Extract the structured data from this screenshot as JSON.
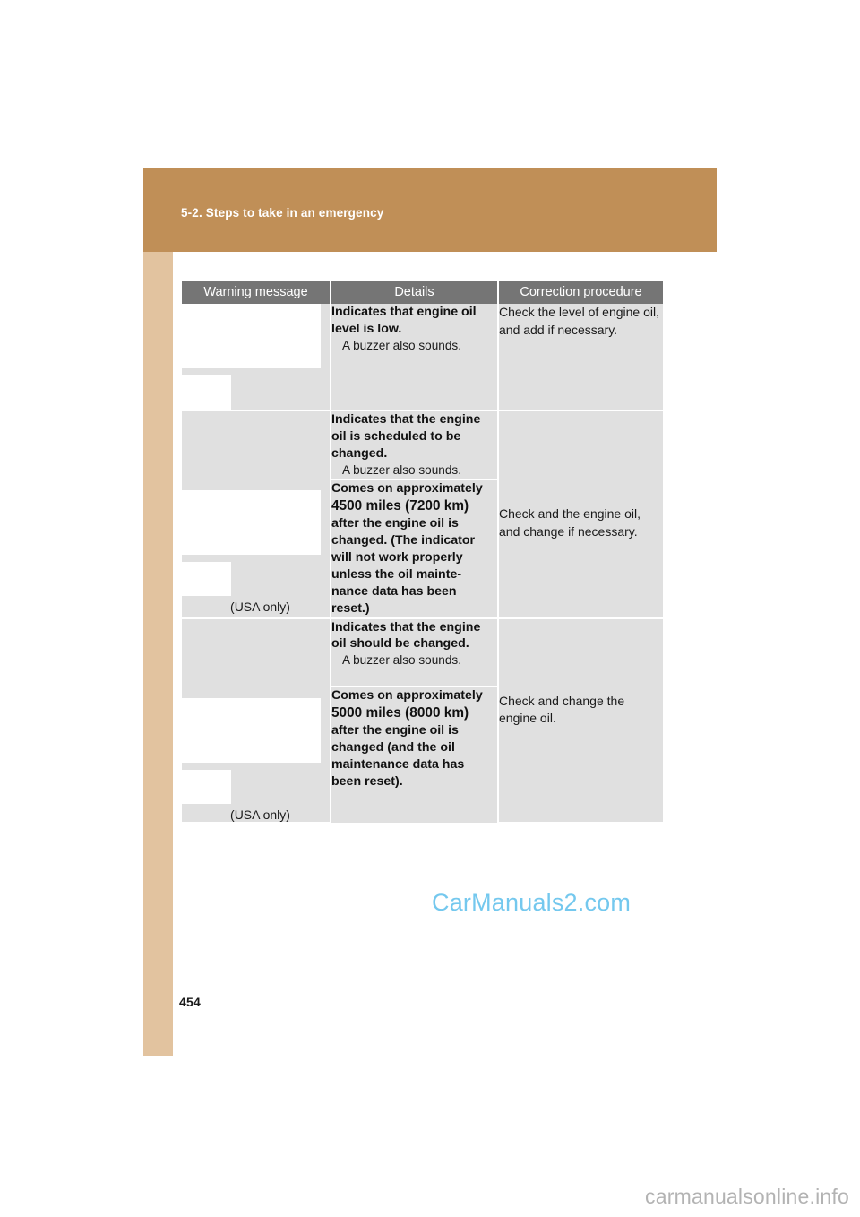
{
  "page": {
    "number": "454",
    "section_title": "5-2. Steps to take in an emergency",
    "header_color": "#c08f57",
    "side_strip_color": "#e2c39f"
  },
  "table": {
    "headers": {
      "warning_message": "Warning message",
      "details": "Details",
      "correction_procedure": "Correction procedure"
    },
    "header_background": "#757575",
    "cell_background": "#e0e0e0",
    "rows": [
      {
        "icon": {
          "wide_box": "warning-icon-placeholder-wide",
          "small_box": "warning-icon-placeholder-small",
          "note": ""
        },
        "details": [
          {
            "main": "Indicates that engine oil level is low.",
            "sub": "A buzzer also sounds."
          }
        ],
        "correction": "Check the level of engine oil, and add if necessary."
      },
      {
        "icon": {
          "wide_box": "warning-icon-placeholder-wide",
          "small_box": "warning-icon-placeholder-small",
          "note": "(USA only)"
        },
        "details": [
          {
            "main": "Indicates that the engine oil is scheduled to be changed.",
            "sub": "A buzzer also sounds."
          },
          {
            "main_before": "Comes on approximately ",
            "emphasis": "4500 miles (7200 km)",
            "main_after": " after the engine oil is changed. (The indicator will not work properly unless the oil mainte-nance data has been reset.)",
            "sub": ""
          }
        ],
        "correction": "Check and the engine oil, and change if necessary."
      },
      {
        "icon": {
          "wide_box": "warning-icon-placeholder-wide",
          "small_box": "warning-icon-placeholder-small",
          "note": "(USA only)"
        },
        "details": [
          {
            "main": "Indicates that the engine oil should be changed.",
            "sub": "A buzzer also sounds."
          },
          {
            "main_before": "Comes on approximately ",
            "emphasis": "5000 miles (8000 km)",
            "main_after": " after the engine oil is changed (and the oil maintenance data has been reset).",
            "sub": ""
          }
        ],
        "correction": "Check and change the engine oil."
      }
    ]
  },
  "watermarks": {
    "center": "CarManuals2.com",
    "bottom": "carmanualsonline.info",
    "center_color": "#74c8ee",
    "bottom_color": "#b3b3b3"
  }
}
